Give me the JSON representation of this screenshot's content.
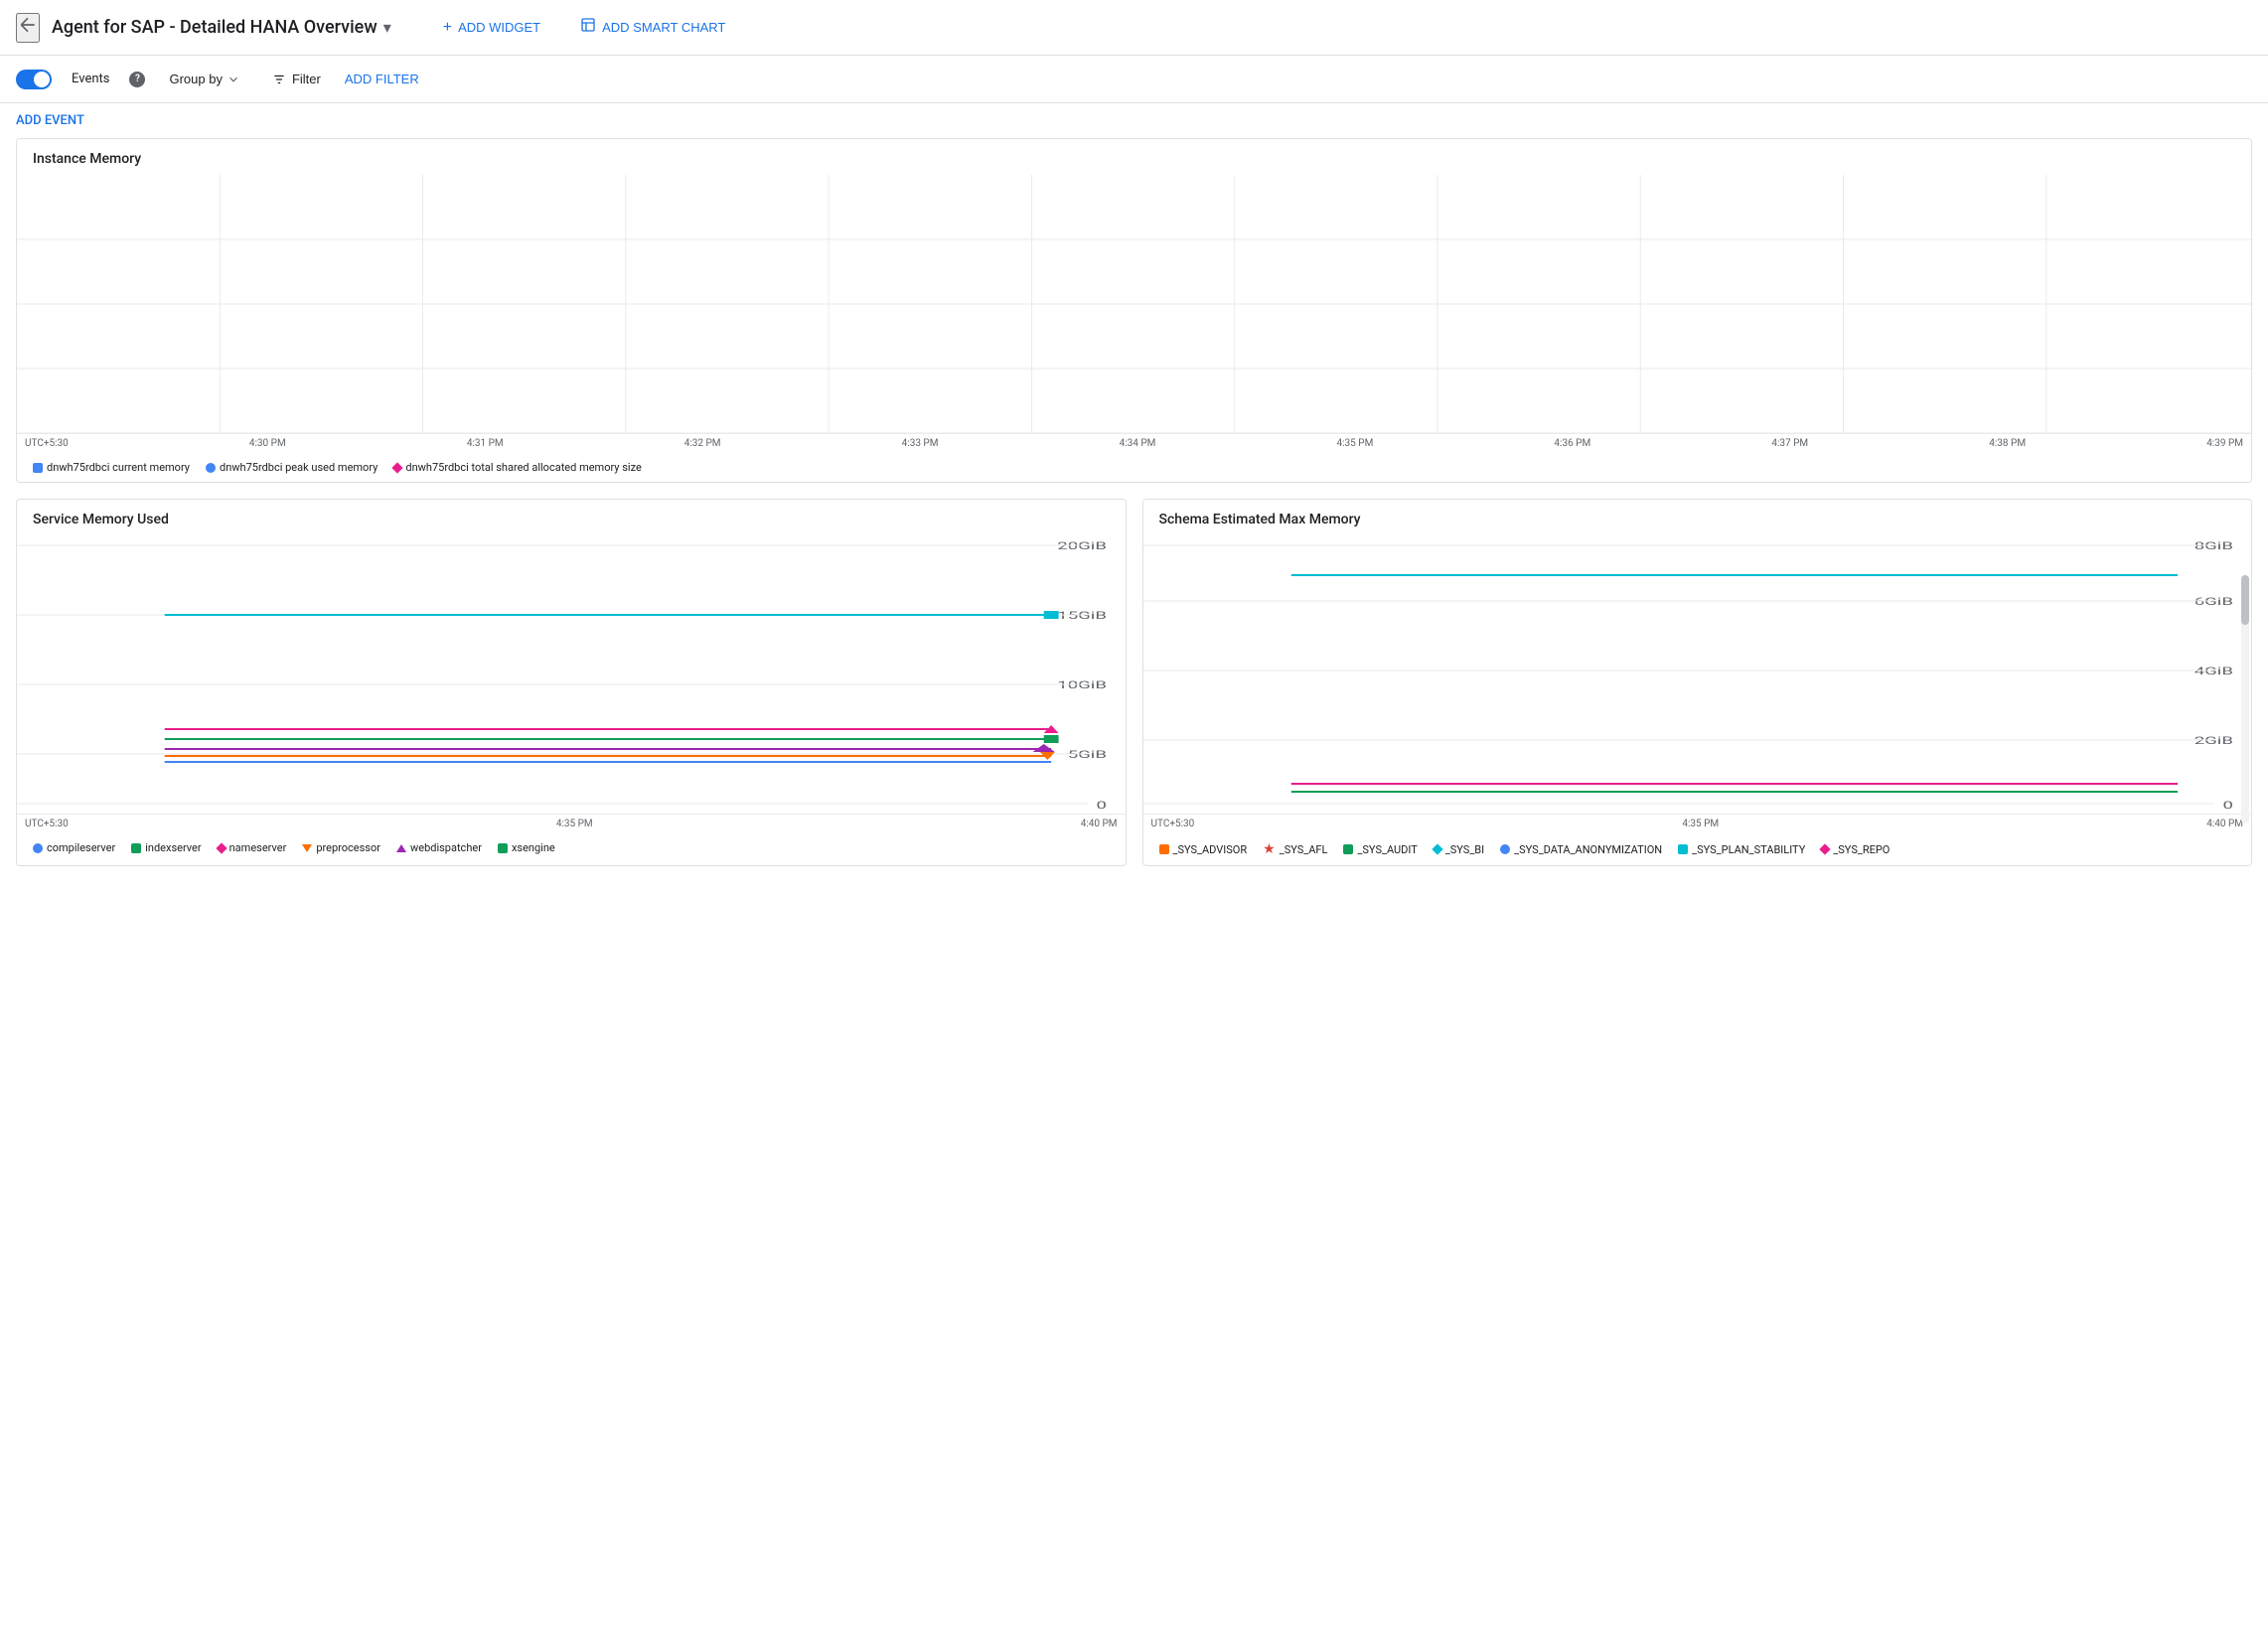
{
  "header": {
    "back_icon": "←",
    "title": "Agent for SAP - Detailed HANA Overview",
    "dropdown_icon": "▾",
    "add_widget_label": "ADD WIDGET",
    "add_smart_chart_label": "ADD SMART CHART"
  },
  "toolbar": {
    "events_label": "Events",
    "info_icon": "?",
    "group_by_label": "Group by",
    "filter_label": "Filter",
    "add_filter_label": "ADD FILTER"
  },
  "add_event": {
    "label": "ADD EVENT"
  },
  "instance_memory_chart": {
    "title": "Instance Memory",
    "x_labels": [
      "UTC+5:30",
      "4:30 PM",
      "4:31 PM",
      "4:32 PM",
      "4:33 PM",
      "4:34 PM",
      "4:35 PM",
      "4:36 PM",
      "4:37 PM",
      "4:38 PM",
      "4:39 PM"
    ],
    "legend": [
      {
        "type": "square",
        "color": "#4285f4",
        "label": "dnwh75rdbci current memory"
      },
      {
        "type": "circle",
        "color": "#4285f4",
        "label": "dnwh75rdbci peak used memory"
      },
      {
        "type": "diamond",
        "color": "#e91e8c",
        "label": "dnwh75rdbci total shared allocated memory size"
      }
    ]
  },
  "service_memory_chart": {
    "title": "Service Memory Used",
    "y_labels": [
      "20GiB",
      "15GiB",
      "10GiB",
      "5GiB",
      "0"
    ],
    "x_labels": [
      "UTC+5:30",
      "4:35 PM",
      "4:40 PM"
    ],
    "legend": [
      {
        "type": "circle",
        "color": "#4285f4",
        "label": "compileserver"
      },
      {
        "type": "square",
        "color": "#0f9d58",
        "label": "indexserver"
      },
      {
        "type": "diamond",
        "color": "#e91e8c",
        "label": "nameserver"
      },
      {
        "type": "triangle-down",
        "color": "#ff6d00",
        "label": "preprocessor"
      },
      {
        "type": "triangle-up",
        "color": "#9c27b0",
        "label": "webdispatcher"
      },
      {
        "type": "square",
        "color": "#0f9d58",
        "label": "xsengine"
      }
    ],
    "lines": [
      {
        "color": "#00bcd4",
        "y_pct": 72,
        "label": "indexserver ~15GiB"
      },
      {
        "color": "#e91e8c",
        "y_pct": 47,
        "label": "nameserver ~5GiB"
      },
      {
        "color": "#0f9d58",
        "y_pct": 44,
        "label": "xsengine ~5GiB"
      },
      {
        "color": "#9c27b0",
        "y_pct": 41,
        "label": "webdispatcher"
      },
      {
        "color": "#ff6d00",
        "y_pct": 38,
        "label": "preprocessor"
      },
      {
        "color": "#4285f4",
        "y_pct": 35,
        "label": "compileserver"
      }
    ]
  },
  "schema_memory_chart": {
    "title": "Schema Estimated Max Memory",
    "y_labels": [
      "8GiB",
      "6GiB",
      "4GiB",
      "2GiB",
      "0"
    ],
    "x_labels": [
      "UTC+5:30",
      "4:35 PM",
      "4:40 PM"
    ],
    "legend": [
      {
        "type": "square",
        "color": "#ff6d00",
        "label": "_SYS_ADVISOR"
      },
      {
        "type": "star",
        "color": "#db4437",
        "label": "_SYS_AFL"
      },
      {
        "type": "square",
        "color": "#0f9d58",
        "label": "_SYS_AUDIT"
      },
      {
        "type": "diamond",
        "color": "#00bcd4",
        "label": "_SYS_BI"
      },
      {
        "type": "circle",
        "color": "#4285f4",
        "label": "_SYS_DATA_ANONYMIZATION"
      },
      {
        "type": "square",
        "color": "#00bcd4",
        "label": "_SYS_PLAN_STABILITY"
      },
      {
        "type": "diamond",
        "color": "#e91e8c",
        "label": "_SYS_REPO"
      }
    ],
    "lines": [
      {
        "color": "#00bcd4",
        "y_pct": 80,
        "label": "_SYS_BI ~7GiB"
      },
      {
        "color": "#e91e8c",
        "y_pct": 22,
        "label": "_SYS_REPO"
      },
      {
        "color": "#0f9d58",
        "y_pct": 18,
        "label": "_SYS_AUDIT"
      }
    ]
  }
}
